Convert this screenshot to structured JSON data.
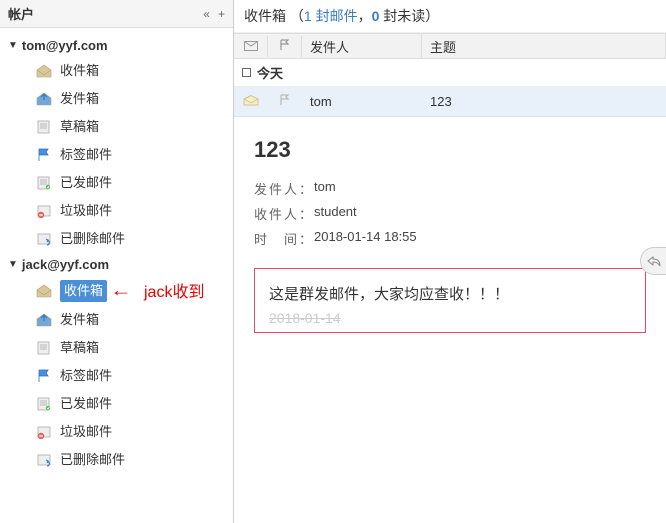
{
  "sidebar": {
    "title": "帐户",
    "collapse_glyph": "«",
    "add_glyph": "+",
    "accounts": [
      {
        "email": "tom@yyf.com",
        "folders": [
          {
            "name": "inbox",
            "label": "收件箱",
            "iconColor": "#d8c89a"
          },
          {
            "name": "outbox",
            "label": "发件箱",
            "iconColor": "#6aa8e8"
          },
          {
            "name": "drafts",
            "label": "草稿箱",
            "iconColor": "#bbb"
          },
          {
            "name": "tagged",
            "label": "标签邮件",
            "iconColor": "#4a90e2"
          },
          {
            "name": "sent",
            "label": "已发邮件",
            "iconColor": "#bbb"
          },
          {
            "name": "trash",
            "label": "垃圾邮件",
            "iconColor": "#bbb"
          },
          {
            "name": "deleted",
            "label": "已删除邮件",
            "iconColor": "#bbb"
          }
        ]
      },
      {
        "email": "jack@yyf.com",
        "folders": [
          {
            "name": "inbox",
            "label": "收件箱",
            "iconColor": "#d8c89a"
          },
          {
            "name": "outbox",
            "label": "发件箱",
            "iconColor": "#6aa8e8"
          },
          {
            "name": "drafts",
            "label": "草稿箱",
            "iconColor": "#bbb"
          },
          {
            "name": "tagged",
            "label": "标签邮件",
            "iconColor": "#4a90e2"
          },
          {
            "name": "sent",
            "label": "已发邮件",
            "iconColor": "#bbb"
          },
          {
            "name": "trash",
            "label": "垃圾邮件",
            "iconColor": "#bbb"
          },
          {
            "name": "deleted",
            "label": "已删除邮件",
            "iconColor": "#bbb"
          }
        ],
        "selected_folder_index": 0
      }
    ]
  },
  "annotation": {
    "text": "jack收到"
  },
  "list": {
    "header_label": "收件箱",
    "count_total_label": "1 封邮件",
    "count_unread_prefix": "，",
    "count_unread_value": "0",
    "count_unread_suffix": " 封未读",
    "columns": {
      "sender": "发件人",
      "subject": "主题"
    },
    "group_label": "今天",
    "rows": [
      {
        "sender": "tom",
        "subject": "123"
      }
    ]
  },
  "preview": {
    "subject": "123",
    "sender_label": "发件人：",
    "sender": "tom",
    "recipient_label": "收件人：",
    "recipient": "student",
    "time_label": "时　间：",
    "time": "2018-01-14  18:55",
    "body": "这是群发邮件，大家均应查收！！！",
    "body_date": "2018-01-14"
  }
}
